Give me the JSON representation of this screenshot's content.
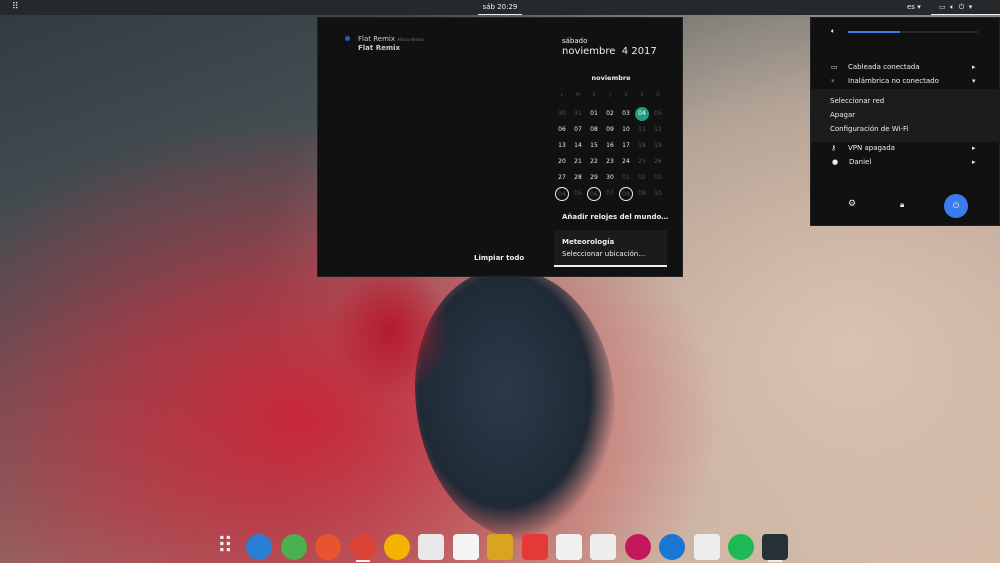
{
  "topbar": {
    "clock": "sáb 20:29",
    "language": "es"
  },
  "notifications": {
    "app": "Flat Remix",
    "time": "Ahora mismo",
    "body": "Flat Remix",
    "clear_all": "Limpiar todo"
  },
  "calendar": {
    "weekday": "sábado",
    "date": "noviembre  4 2017",
    "month": "noviembre",
    "day_headers": [
      "L",
      "M",
      "X",
      "J",
      "V",
      "S",
      "D"
    ],
    "weeks": [
      [
        "30",
        "31",
        "01",
        "02",
        "03",
        "04",
        "05"
      ],
      [
        "06",
        "07",
        "08",
        "09",
        "10",
        "11",
        "12"
      ],
      [
        "13",
        "14",
        "15",
        "16",
        "17",
        "18",
        "19"
      ],
      [
        "20",
        "21",
        "22",
        "23",
        "24",
        "25",
        "26"
      ],
      [
        "27",
        "28",
        "29",
        "30",
        "01",
        "02",
        "03"
      ],
      [
        "04",
        "05",
        "06",
        "07",
        "08",
        "09",
        "10"
      ]
    ],
    "today": "04",
    "accent": "#1e9e85",
    "world_clocks": "Añadir relojes del mundo…",
    "weather_title": "Meteorología",
    "weather_sub": "Seleccionar ubicación…"
  },
  "system_menu": {
    "volume_percent": 40,
    "accent": "#3a7bf0",
    "wired": "Cableada conectada",
    "wireless": "Inalámbrica no conectado",
    "wifi_submenu": [
      "Seleccionar red",
      "Apagar",
      "Configuración de Wi-Fi"
    ],
    "vpn": "VPN apagada",
    "user": "Daniel"
  },
  "dock": [
    {
      "icon": "app-grid-icon",
      "color": "transparent"
    },
    {
      "icon": "settings-icon",
      "color": "#2a7fd4"
    },
    {
      "icon": "pie-chart-app-icon",
      "color": "#4caf50"
    },
    {
      "icon": "firefox-icon",
      "color": "#e8542e"
    },
    {
      "icon": "chrome-icon",
      "color": "#db4437"
    },
    {
      "icon": "lightbulb-icon",
      "color": "#f2b400"
    },
    {
      "icon": "mail-icon",
      "color": "#e8e8e8"
    },
    {
      "icon": "document-editor-icon",
      "color": "#f4f4f4"
    },
    {
      "icon": "robot-arm-icon",
      "color": "#d9a520"
    },
    {
      "icon": "filezilla-icon",
      "color": "#e53935"
    },
    {
      "icon": "files-icon",
      "color": "#f0f0f0"
    },
    {
      "icon": "music-player-icon",
      "color": "#eeeeee"
    },
    {
      "icon": "lollypop-icon",
      "color": "#c2185b"
    },
    {
      "icon": "system-monitor-icon",
      "color": "#1976d2"
    },
    {
      "icon": "download-manager-icon",
      "color": "#eeeeee"
    },
    {
      "icon": "spotify-icon",
      "color": "#1db954"
    },
    {
      "icon": "terminal-icon",
      "color": "#263238"
    }
  ]
}
